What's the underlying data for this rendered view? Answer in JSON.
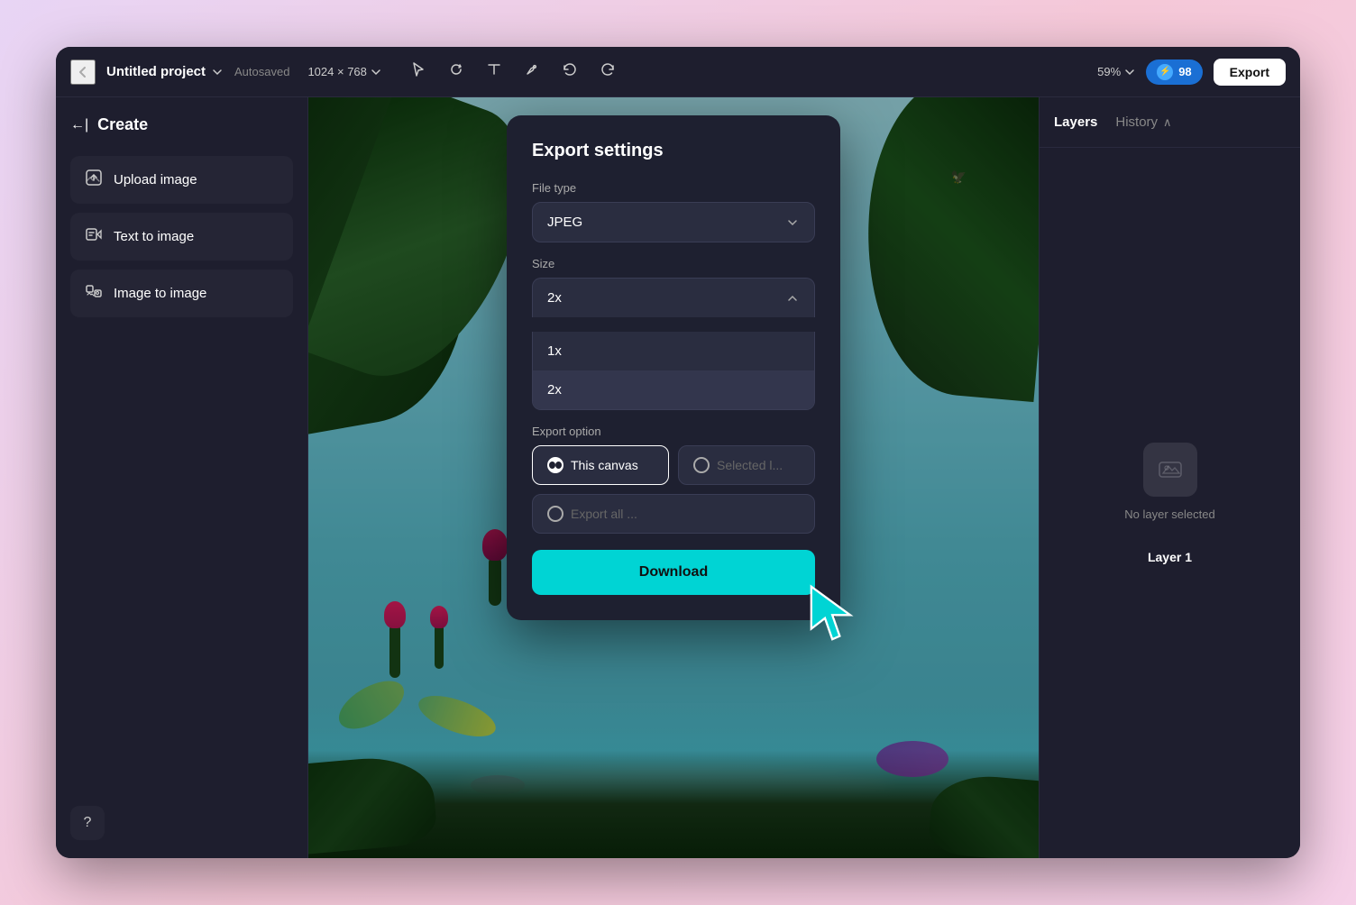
{
  "app": {
    "window_title": "Untitled project"
  },
  "header": {
    "back_label": "←",
    "project_name": "Untitled project",
    "autosaved": "Autosaved",
    "canvas_size": "1024 × 768",
    "zoom": "59%",
    "credits": "98",
    "export_label": "Export"
  },
  "sidebar": {
    "create_label": "Create",
    "back_icon": "←|",
    "items": [
      {
        "id": "upload-image",
        "label": "Upload image",
        "icon": "⬆"
      },
      {
        "id": "text-to-image",
        "label": "Text to image",
        "icon": "⤷"
      },
      {
        "id": "image-to-image",
        "label": "Image to image",
        "icon": "🖼"
      }
    ],
    "help_icon": "?"
  },
  "right_panel": {
    "layers_tab": "Layers",
    "history_tab": "History",
    "history_chevron": "∧",
    "no_layer_text": "No layer selected",
    "layer_1_label": "Layer 1"
  },
  "export_modal": {
    "title": "Export settings",
    "file_type_label": "File type",
    "file_type_value": "JPEG",
    "size_label": "Size",
    "size_value": "2x",
    "size_options": [
      "1x",
      "2x"
    ],
    "export_option_label": "Export option",
    "this_canvas_label": "This canvas",
    "selected_label": "Selected l...",
    "export_all_label": "Export all ...",
    "download_label": "Download"
  },
  "colors": {
    "accent_cyan": "#00d4d4",
    "bg_dark": "#1e2030",
    "bg_sidebar": "#1e1e2e",
    "bg_item": "#252535"
  }
}
